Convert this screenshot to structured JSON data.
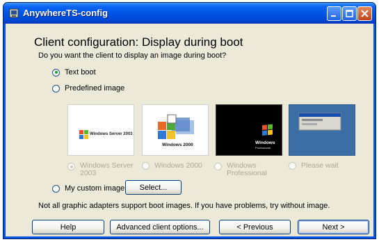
{
  "window": {
    "title": "AnywhereTS-config"
  },
  "page": {
    "heading": "Client configuration: Display during boot",
    "question": "Do you want the client to display an image during boot?"
  },
  "options": {
    "text_boot": "Text boot",
    "predefined_image": "Predefined image",
    "custom_image": "My custom image",
    "select_button": "Select..."
  },
  "images": [
    {
      "label_line1": "Windows Server",
      "label_line2": "2003",
      "selected": true,
      "caption": "Windows Server 2003"
    },
    {
      "label_line1": "Windows 2000",
      "label_line2": "",
      "selected": false,
      "caption": "Windows 2000"
    },
    {
      "label_line1": "Windows",
      "label_line2": "Professional",
      "selected": false,
      "caption": "Windows",
      "caption_sub": "Professional"
    },
    {
      "label_line1": "Please wait",
      "label_line2": "",
      "selected": false
    }
  ],
  "note": "Not all graphic adapters support boot images. If you have problems, try without image.",
  "buttons": {
    "help": "Help",
    "advanced": "Advanced client options...",
    "previous": "< Previous",
    "next": "Next >"
  },
  "colors": {
    "titlebar": "#0054e3",
    "dialog_bg": "#ece9d8",
    "thumb4_bg": "#3a6ea5"
  }
}
